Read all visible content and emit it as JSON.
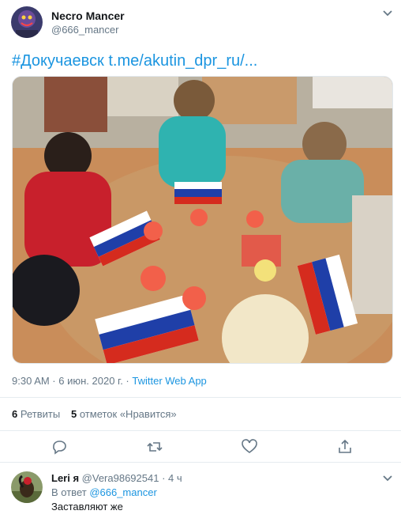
{
  "tweet": {
    "author_name": "Necro Mancer",
    "author_handle": "@666_mancer",
    "text": "#Докучаевск t.me/akutin_dpr_ru/...",
    "photo_alt": "Photo: children painting flags at a table",
    "timestamp": "9:30 AM · 6 июн. 2020 г. · ",
    "source": "Twitter Web App",
    "retweets_count": "6",
    "retweets_label": "Ретвиты",
    "likes_count": "5",
    "likes_label": "отметок «Нравится»"
  },
  "actions": {
    "icons": [
      "reply-icon",
      "retweet-icon",
      "like-icon",
      "share-icon"
    ]
  },
  "reply": {
    "author_name": "Leri я",
    "author_handle": "@Vera98692541",
    "time": " · 4 ч",
    "reply_prefix": "В ответ ",
    "reply_target": "@666_mancer",
    "text": "Заставляют же"
  },
  "colors": {
    "accent": "#1b95e0",
    "secondary_text": "#657786",
    "divider": "#e6ecf0",
    "flag_white": "#ffffff",
    "flag_blue": "#1f3fa8",
    "flag_red": "#d52b1e"
  }
}
